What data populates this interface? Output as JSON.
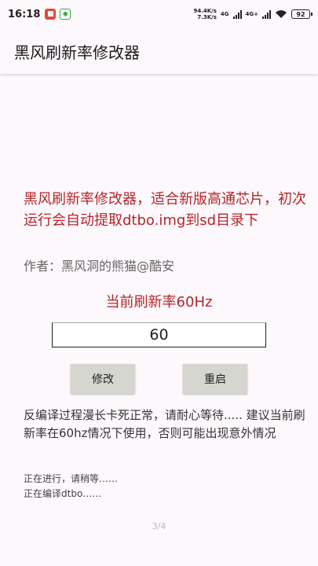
{
  "status_bar": {
    "time": "16:18",
    "net_speed_down": "94.4K/s",
    "net_speed_up": "7.3K/s",
    "net_type_1": "4G",
    "net_type_2": "4G+",
    "battery": "92"
  },
  "app_bar": {
    "title": "黑风刷新率修改器"
  },
  "main": {
    "description": "黑风刷新率修改器，适合新版高通芯片，初次运行会自动提取dtbo.img到sd目录下",
    "author": "作者：黑风洞的熊猫@酷安",
    "current_rate": "当前刷新率60Hz",
    "rate_input_value": "60",
    "modify_button": "修改",
    "reboot_button": "重启",
    "notice": "反编译过程漫长卡死正常，请耐心等待..... 建议当前刷新率在60hz情况下使用，否则可能出现意外情况",
    "log_lines": [
      "正在进行，请稍等……",
      "正在编译dtbo……"
    ]
  },
  "pager": "3/4",
  "colors": {
    "accent_red": "#b3262a",
    "button_bg": "#d5d6d0"
  }
}
